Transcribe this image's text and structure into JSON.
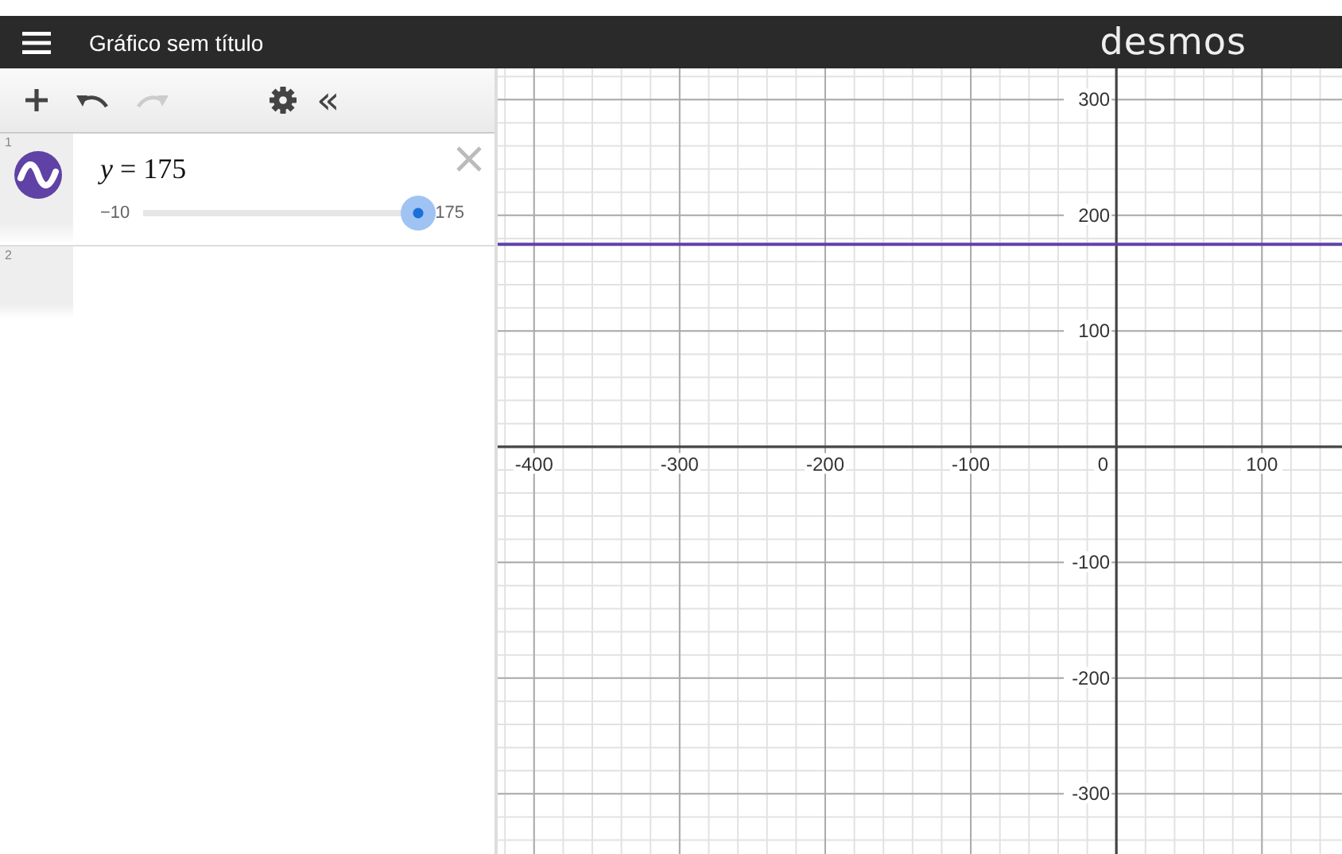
{
  "header": {
    "title": "Gráfico sem título",
    "logo": "desmos"
  },
  "toolbar": {
    "redo_disabled": true,
    "collapse": "«"
  },
  "expressions": [
    {
      "index": "1",
      "latex": "*y* = 175",
      "color": "#6042a6",
      "slider": {
        "min": "−10",
        "max": "175",
        "level": 1
      }
    },
    {
      "index": "2"
    }
  ],
  "graph": {
    "chart_data": {
      "type": "line",
      "xlim": [
        -425,
        155
      ],
      "ylim": [
        -352,
        327
      ],
      "grid": true,
      "xticks": [
        -400,
        -300,
        -200,
        -100,
        100
      ],
      "yticks": [
        -300,
        -200,
        -100,
        100,
        200,
        300
      ],
      "series": [
        {
          "color": "#6042a6",
          "x": [
            -425,
            155
          ],
          "values": [
            175,
            175
          ]
        }
      ]
    },
    "origin_label": "0"
  }
}
